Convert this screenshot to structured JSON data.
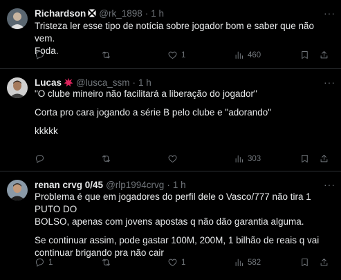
{
  "tweets": [
    {
      "name": "Richardson",
      "badge_icon": "club-crest-icon",
      "handle": "@rk_1898",
      "time": "1 h",
      "lines": [
        "Tristeza ler esse tipo de notícia sobre jogador bom e saber que não vem.",
        "Foda."
      ],
      "replies": "",
      "retweets": "",
      "likes": "1",
      "views": "460"
    },
    {
      "name": "Lucas",
      "badge_icon": "red-burst-icon",
      "handle": "@lusca_ssm",
      "time": "1 h",
      "lines": [
        "\"O clube mineiro não facilitará a liberação do jogador\"",
        "",
        "Corta pro cara jogando a série B pelo clube e \"adorando\"",
        "",
        "kkkkk"
      ],
      "replies": "",
      "retweets": "",
      "likes": "",
      "views": "303"
    },
    {
      "name": "renan crvg 0/45",
      "badge_icon": "",
      "handle": "@rlp1994crvg",
      "time": "1 h",
      "lines": [
        "Problema é que em jogadores do perfil dele o Vasco/777 não tira 1 PUTO DO",
        "BOLSO, apenas com jovens apostas q não dão garantia alguma.",
        "",
        "Se continuar assim, pode gastar 100M, 200M, 1 bilhão de reais q vai",
        "continuar brigando pra não cair"
      ],
      "replies": "1",
      "retweets": "",
      "likes": "1",
      "views": "582"
    }
  ],
  "colors": {
    "background": "#000000",
    "text": "#e7e9ea",
    "secondary": "#71767b",
    "divider": "#2f3336"
  }
}
